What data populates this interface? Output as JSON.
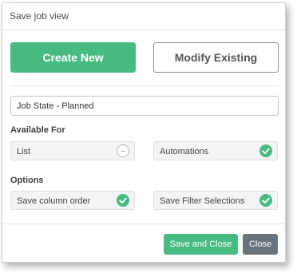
{
  "dialog": {
    "title": "Save job view"
  },
  "mode_buttons": {
    "create_label": "Create New",
    "modify_label": "Modify Existing"
  },
  "view_name": {
    "value": "Job State - Planned"
  },
  "available_for": {
    "heading": "Available For",
    "items": [
      {
        "label": "List",
        "checked": false,
        "icon": "empty-circle-icon"
      },
      {
        "label": "Automations",
        "checked": true,
        "icon": "check-circle-icon"
      }
    ]
  },
  "options": {
    "heading": "Options",
    "items": [
      {
        "label": "Save column order",
        "checked": true,
        "icon": "check-circle-icon"
      },
      {
        "label": "Save Filter Selections",
        "checked": true,
        "icon": "check-circle-icon"
      }
    ]
  },
  "footer": {
    "save_close_label": "Save and Close",
    "close_label": "Close"
  },
  "colors": {
    "accent_green": "#48bb82",
    "close_gray": "#6a747d"
  }
}
